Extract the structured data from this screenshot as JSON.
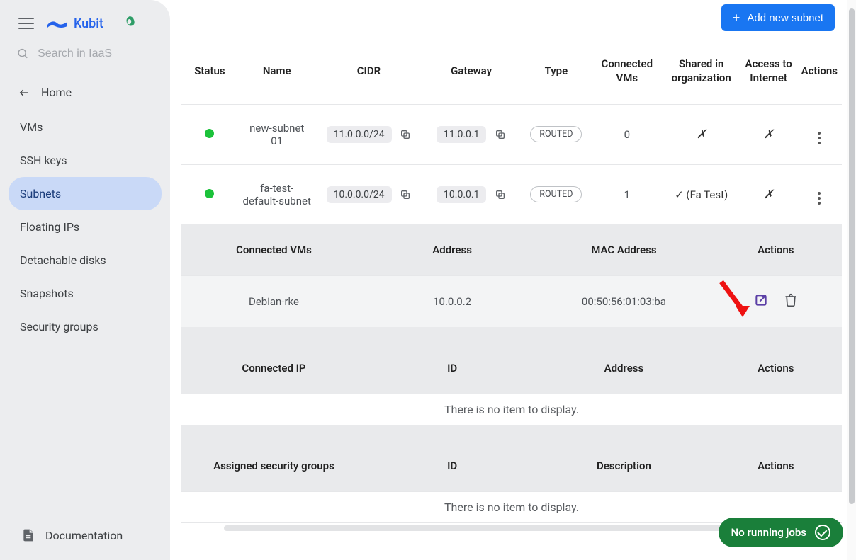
{
  "brand": {
    "name": "Kubit"
  },
  "search": {
    "placeholder": "Search in IaaS"
  },
  "home": {
    "label": "Home"
  },
  "nav": {
    "items": [
      {
        "label": "VMs"
      },
      {
        "label": "SSH keys"
      },
      {
        "label": "Subnets"
      },
      {
        "label": "Floating IPs"
      },
      {
        "label": "Detachable disks"
      },
      {
        "label": "Snapshots"
      },
      {
        "label": "Security groups"
      }
    ],
    "activeIndex": 2
  },
  "doc": {
    "label": "Documentation"
  },
  "actions": {
    "add_subnet": "Add new subnet"
  },
  "table": {
    "headers": {
      "status": "Status",
      "name": "Name",
      "cidr": "CIDR",
      "gateway": "Gateway",
      "type": "Type",
      "connected_vms": "Connected VMs",
      "shared": "Shared in organization",
      "internet": "Access to Internet",
      "actions": "Actions"
    },
    "rows": [
      {
        "status": "up",
        "name": "new-subnet 01",
        "cidr": "11.0.0.0/24",
        "gateway": "11.0.0.1",
        "type": "ROUTED",
        "connected_vms": "0",
        "shared": "✗",
        "internet": "✗"
      },
      {
        "status": "up",
        "name": "fa-test-default-subnet",
        "cidr": "10.0.0.0/24",
        "gateway": "10.0.0.1",
        "type": "ROUTED",
        "connected_vms": "1",
        "shared": "✓ (Fa Test)",
        "internet": "✗"
      }
    ]
  },
  "detail": {
    "vms": {
      "headers": {
        "name": "Connected VMs",
        "address": "Address",
        "mac": "MAC Address",
        "actions": "Actions"
      },
      "rows": [
        {
          "name": "Debian-rke",
          "address": "10.0.0.2",
          "mac": "00:50:56:01:03:ba"
        }
      ]
    },
    "ips": {
      "headers": {
        "name": "Connected IP",
        "id": "ID",
        "address": "Address",
        "actions": "Actions"
      },
      "empty": "There is no item to display."
    },
    "sg": {
      "headers": {
        "name": "Assigned security groups",
        "id": "ID",
        "desc": "Description",
        "actions": "Actions"
      },
      "empty": "There is no item to display."
    }
  },
  "jobs": {
    "label": "No running jobs"
  }
}
